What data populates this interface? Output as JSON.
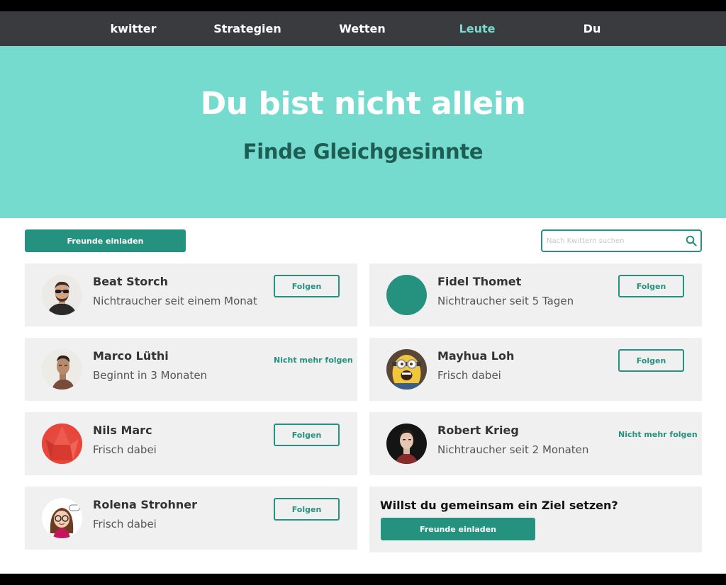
{
  "nav": {
    "items": [
      {
        "label": "kwitter",
        "active": false
      },
      {
        "label": "Strategien",
        "active": false
      },
      {
        "label": "Wetten",
        "active": false
      },
      {
        "label": "Leute",
        "active": true
      },
      {
        "label": "Du",
        "active": false
      }
    ]
  },
  "hero": {
    "title": "Du bist nicht allein",
    "subtitle": "Finde Gleichgesinnte"
  },
  "toolbar": {
    "invite_label": "Freunde einladen",
    "search_placeholder": "Nach Kwittern suchen",
    "search_value": ""
  },
  "people": [
    {
      "name": "Beat Storch",
      "status": "Nichtraucher seit einem Monat",
      "action": "Folgen",
      "following": false,
      "avatar": "man-sunglasses-photo"
    },
    {
      "name": "Fidel Thomet",
      "status": "Nichtraucher seit 5 Tagen",
      "action": "Folgen",
      "following": false,
      "avatar": "teal-circle"
    },
    {
      "name": "Marco Lüthi",
      "status": "Beginnt in 3 Monaten",
      "action": "Nicht mehr folgen",
      "following": true,
      "avatar": "man-portrait-photo"
    },
    {
      "name": "Mayhua Loh",
      "status": "Frisch dabei",
      "action": "Folgen",
      "following": false,
      "avatar": "minion-photo"
    },
    {
      "name": "Nils Marc",
      "status": "Frisch dabei",
      "action": "Folgen",
      "following": false,
      "avatar": "red-polygon"
    },
    {
      "name": "Robert Krieg",
      "status": "Nichtraucher seit 2 Monaten",
      "action": "Nicht mehr folgen",
      "following": true,
      "avatar": "young-man-photo"
    },
    {
      "name": "Rolena Strohner",
      "status": "Frisch dabei",
      "action": "Folgen",
      "following": false,
      "avatar": "cartoon-girl-drawing"
    }
  ],
  "promo": {
    "title": "Willst du gemeinsam ein Ziel setzen?",
    "button_label": "Freunde einladen"
  },
  "colors": {
    "accent": "#25917f",
    "hero_bg": "#76dbcf",
    "nav_bg": "#3a3b3e",
    "nav_active": "#76dbcf",
    "card_bg": "#f0f0f0",
    "subtitle": "#1d5d54"
  }
}
